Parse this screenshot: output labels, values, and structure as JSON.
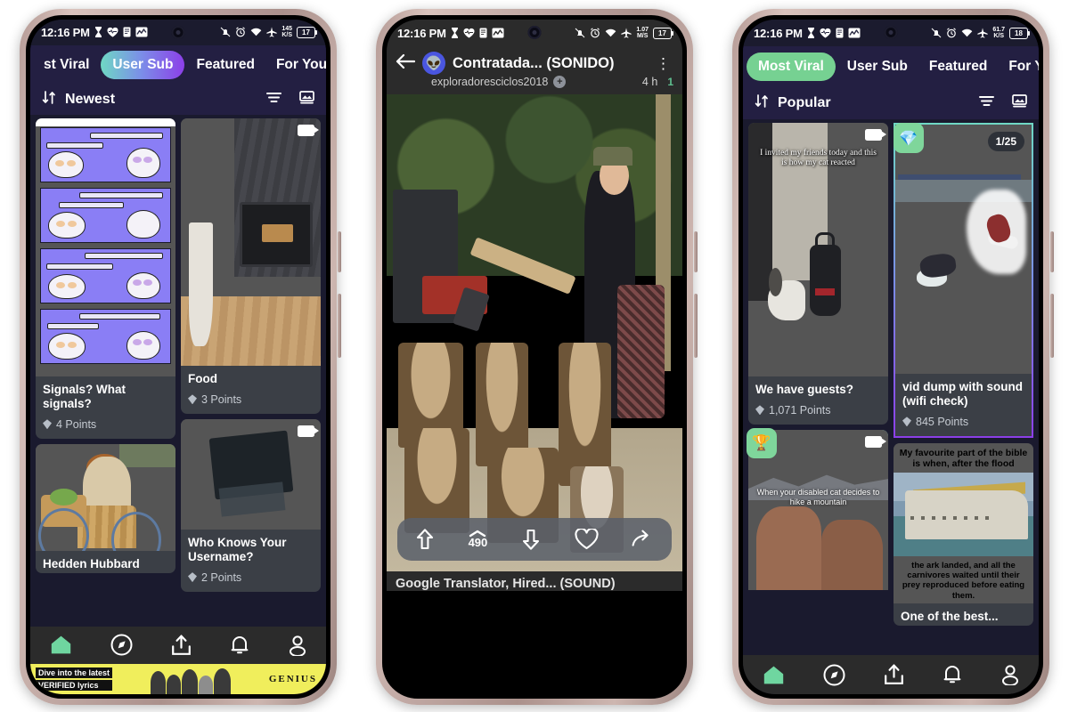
{
  "status_bar": {
    "time": "12:16 PM",
    "left_icons": [
      "hourglass-icon",
      "heart-pulse-icon",
      "note-icon",
      "activity-graph-icon"
    ],
    "right_icons": [
      "notifications-off-icon",
      "alarm-icon",
      "wifi-icon",
      "airplane-mode-icon"
    ],
    "phone1": {
      "data_rate": "145",
      "data_unit": "K/S",
      "battery": "17"
    },
    "phone2": {
      "data_rate": "1.07",
      "data_unit": "M/S",
      "battery": "17"
    },
    "phone3": {
      "data_rate": "61.7",
      "data_unit": "K/S",
      "battery": "18"
    }
  },
  "phone1": {
    "tabs": [
      {
        "label": "st Viral",
        "active": false
      },
      {
        "label": "User Sub",
        "active": true
      },
      {
        "label": "Featured",
        "active": false
      },
      {
        "label": "For You",
        "active": false
      }
    ],
    "sort": {
      "label": "Newest",
      "sort_icon": "sort-updown-icon",
      "filter_icon": "filter-icon",
      "layout_icon": "layout-image-icon"
    },
    "cards": [
      {
        "title": "Signals? What signals?",
        "points": "4 Points",
        "art": "comic",
        "video": false
      },
      {
        "title": "Hedden Hubbard",
        "points": "",
        "art": "bike",
        "video": false
      },
      {
        "title": "Food",
        "points": "3 Points",
        "art": "room",
        "video": true
      },
      {
        "title": "Who Knows Your Username?",
        "points": "2 Points",
        "art": "ice",
        "video": true
      }
    ],
    "ad": {
      "line1": "Dive into the latest",
      "line2": "VERIFIED lyrics",
      "brand": "GENIUS"
    }
  },
  "phone2": {
    "back_icon": "back-arrow-icon",
    "avatar_icon": "alien-avatar-icon",
    "title": "Contratada... (SONIDO)",
    "kebab_icon": "more-options-icon",
    "username": "exploradoresciclos2018",
    "follow_icon": "plus-icon",
    "time": "4 h",
    "new_badge": "1",
    "actions": {
      "upvote_icon": "upvote-arrow-icon",
      "vote_count": "490",
      "downvote_icon": "downvote-arrow-icon",
      "favorite_icon": "heart-icon",
      "share_icon": "share-arrow-icon"
    },
    "caption": "Google Translator, Hired... (SOUND)"
  },
  "phone3": {
    "tabs": [
      {
        "label": "Most Viral",
        "active": true
      },
      {
        "label": "User Sub",
        "active": false
      },
      {
        "label": "Featured",
        "active": false
      },
      {
        "label": "For Y",
        "active": false
      }
    ],
    "sort": {
      "label": "Popular",
      "sort_icon": "sort-updown-icon",
      "filter_icon": "filter-icon",
      "layout_icon": "layout-image-icon"
    },
    "cards": [
      {
        "title": "We have guests?",
        "points": "1,071 Points",
        "art": "cat",
        "video": true,
        "overlay": "I invited my friends today and this is how my cat reacted"
      },
      {
        "title": "vid dump with sound (wifi check)",
        "points": "845 Points",
        "art": "surf",
        "counter": "1/25",
        "badge": "gem-badge-icon",
        "highlighted": true
      },
      {
        "title": "",
        "points": "",
        "art": "mountain",
        "video": true,
        "badge": "trophy-sunglasses-badge-icon",
        "overlay": "When your disabled cat decides to hike a mountain"
      },
      {
        "title": "One of the best...",
        "points": "",
        "art": "meme",
        "meme_top": "My favourite part of the bible is when, after the flood",
        "meme_bottom": "the ark landed, and all the carnivores waited until their prey reproduced before eating them."
      }
    ]
  },
  "nav": {
    "items": [
      {
        "name": "home",
        "icon": "home-icon",
        "active": true
      },
      {
        "name": "explore",
        "icon": "compass-icon",
        "active": false
      },
      {
        "name": "upload",
        "icon": "upload-icon",
        "active": false
      },
      {
        "name": "notifications",
        "icon": "bell-icon",
        "active": false
      },
      {
        "name": "profile",
        "icon": "person-icon",
        "active": false
      }
    ]
  },
  "colors": {
    "tab_bg": "#231f42",
    "feed_bg": "#1a1a2e",
    "card_bg": "#3b3f46",
    "nav_bg": "#2b2b2b",
    "accent_green": "#76d192",
    "accent_purple": "#8c3fe8",
    "accent_teal": "#6fd8c4",
    "ad_yellow": "#f0ee5c"
  }
}
